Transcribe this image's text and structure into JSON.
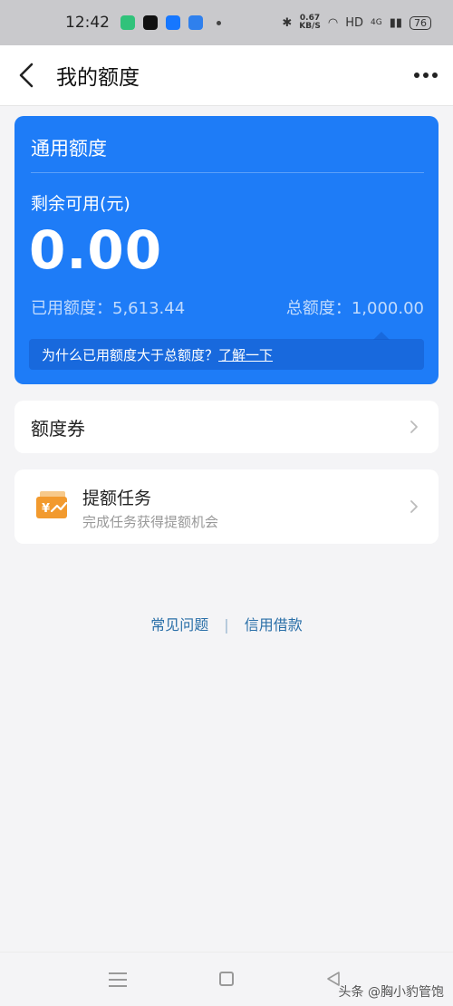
{
  "status_bar": {
    "time": "12:42",
    "net_speed_value": "0.67",
    "net_speed_unit": "KB/S",
    "hd_label": "HD",
    "signal_label": "4G",
    "battery": "76"
  },
  "nav": {
    "title": "我的额度"
  },
  "quota_card": {
    "title": "通用额度",
    "remain_label": "剩余可用(元)",
    "remain_value": "0.00",
    "used_label": "已用额度：",
    "used_value": "5,613.44",
    "total_label": "总额度：",
    "total_value": "1,000.00",
    "tip_text": "为什么已用额度大于总额度？",
    "tip_link": "了解一下"
  },
  "coupon": {
    "label": "额度券"
  },
  "task": {
    "title": "提额任务",
    "subtitle": "完成任务获得提额机会"
  },
  "footer": {
    "faq": "常见问题",
    "separator": "|",
    "credit_loan": "信用借款"
  },
  "watermark": "头条 @胸小豹管饱",
  "colors": {
    "accent_blue": "#1e7cf7",
    "link_blue": "#2a6fa8",
    "task_orange": "#f29a2e"
  },
  "icons": {
    "back": "chevron-left-icon",
    "more": "more-dots-icon",
    "arrow": "chevron-right-icon",
    "task": "yuan-coupon-icon"
  }
}
